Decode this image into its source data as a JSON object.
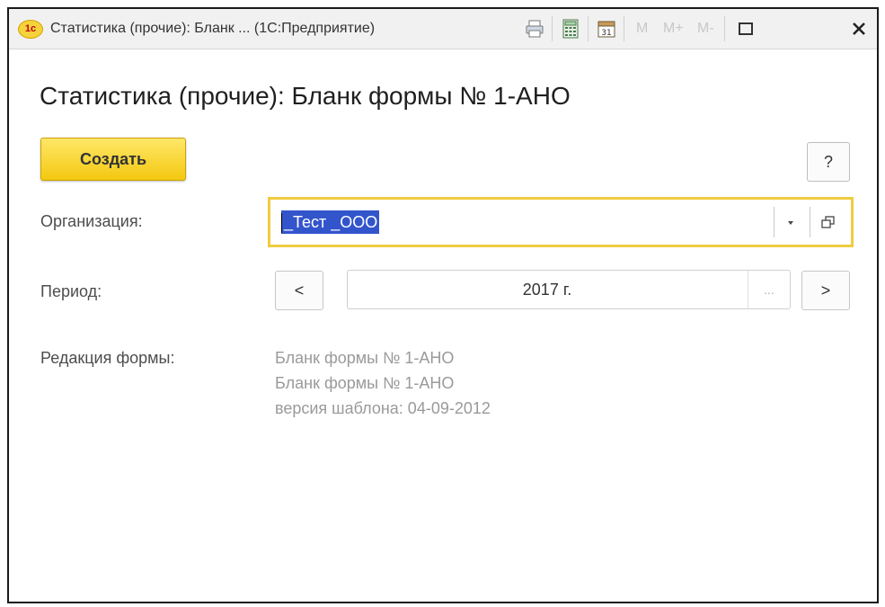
{
  "window": {
    "title": "Статистика (прочие): Бланк ...  (1С:Предприятие)",
    "logo_text": "1с",
    "toolbar": {
      "icons": [
        "print-icon",
        "calculator-icon",
        "calendar-icon"
      ],
      "calendar_day": "31",
      "mem_labels": [
        "M",
        "M+",
        "M-"
      ]
    },
    "controls": [
      "maximize-icon",
      "close-icon"
    ]
  },
  "heading": "Статистика (прочие): Бланк формы № 1-АНО",
  "buttons": {
    "create": "Создать",
    "help": "?"
  },
  "organization": {
    "label": "Организация:",
    "value": "_Тест _ООО"
  },
  "period": {
    "label": "Период:",
    "prev": "<",
    "value": "2017 г.",
    "more": "...",
    "next": ">"
  },
  "edition": {
    "label": "Редакция формы:",
    "lines": [
      "Бланк формы № 1-АНО",
      "Бланк формы № 1-АНО",
      "версия шаблона: 04-09-2012"
    ]
  },
  "colors": {
    "accent": "#f3c80f",
    "selection": "#3355cc",
    "focus_border": "#f0cc40"
  }
}
